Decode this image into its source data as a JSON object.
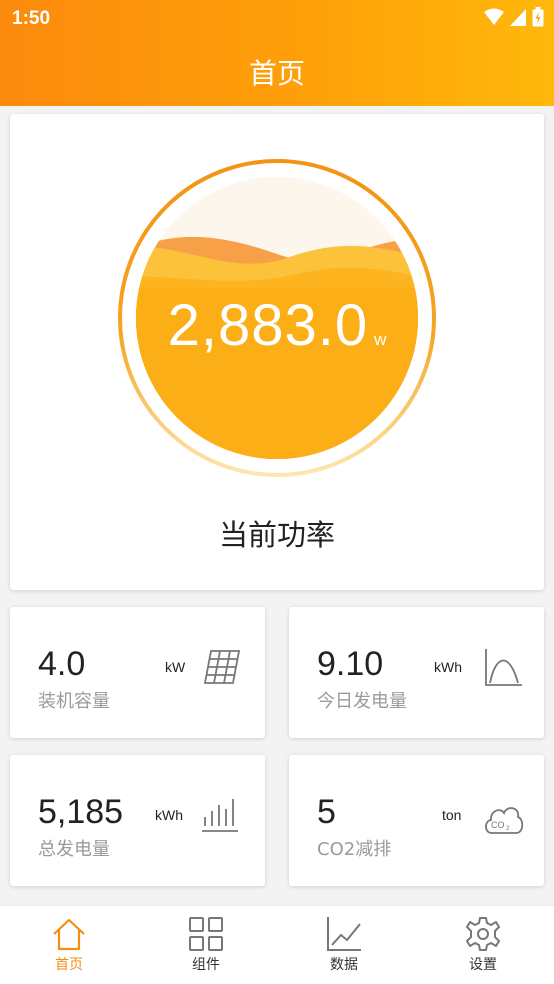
{
  "status_bar": {
    "time": "1:50"
  },
  "header": {
    "title": "首页"
  },
  "power": {
    "value": "2,883.0",
    "unit": "w",
    "label": "当前功率",
    "fill_level": 0.62
  },
  "stats": [
    {
      "value": "4.0",
      "label": "装机容量",
      "unit": "kW",
      "icon": "solar-panel-icon"
    },
    {
      "value": "9.10",
      "label": "今日发电量",
      "unit": "kWh",
      "icon": "generation-curve-icon"
    },
    {
      "value": "5,185",
      "label": "总发电量",
      "unit": "kWh",
      "icon": "bar-columns-icon"
    },
    {
      "value": "5",
      "label": "CO2减排",
      "unit": "ton",
      "icon": "co2-cloud-icon"
    }
  ],
  "nav": [
    {
      "label": "首页",
      "icon": "home-icon",
      "active": true
    },
    {
      "label": "组件",
      "icon": "grid-icon",
      "active": false
    },
    {
      "label": "数据",
      "icon": "line-chart-icon",
      "active": false
    },
    {
      "label": "设置",
      "icon": "gear-icon",
      "active": false
    }
  ],
  "colors": {
    "accent": "#f28f12",
    "header_start": "#fb8a0c",
    "header_end": "#ffb80b"
  }
}
